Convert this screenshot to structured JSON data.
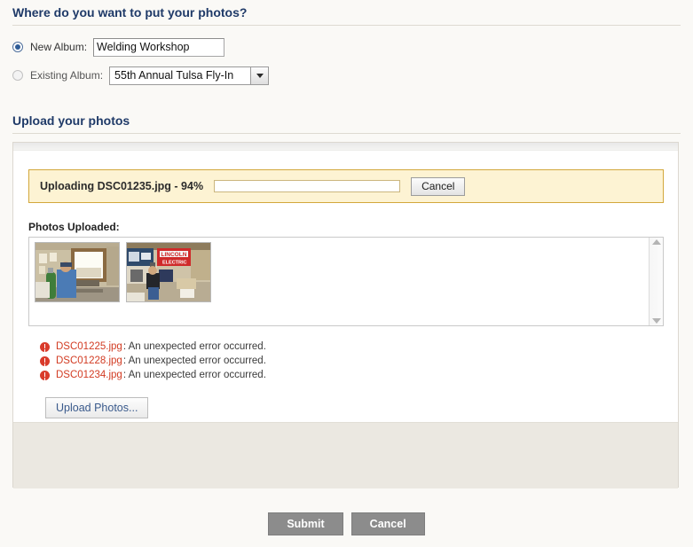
{
  "destination": {
    "heading": "Where do you want to put your photos?",
    "new_album": {
      "label": "New Album:",
      "selected": true,
      "value": "Welding Workshop",
      "placeholder": ""
    },
    "existing_album": {
      "label": "Existing Album:",
      "selected": false,
      "value": "55th Annual Tulsa Fly-In",
      "options": [
        "55th Annual Tulsa Fly-In"
      ]
    }
  },
  "upload": {
    "heading": "Upload your photos",
    "status": {
      "text": "Uploading DSC01235.jpg - 94%",
      "percent": 94,
      "cancel_label": "Cancel",
      "bar_color": "#12a2dd",
      "box_background": "#fdf3d3",
      "box_border": "#d3a83c"
    },
    "photos_label": "Photos Uploaded:",
    "thumbnails": [
      {
        "alt": "Man in blue shirt with green gas cylinder beside bright window in workshop"
      },
      {
        "alt": "Workshop with red LINCOLN ELECTRIC banner and person in dark jacket"
      }
    ],
    "errors": [
      {
        "file": "DSC01225.jpg",
        "message": ": An unexpected error occurred."
      },
      {
        "file": "DSC01228.jpg",
        "message": ": An unexpected error occurred."
      },
      {
        "file": "DSC01234.jpg",
        "message": ": An unexpected error occurred."
      }
    ],
    "error_color": "#d23b22",
    "upload_button_label": "Upload Photos..."
  },
  "actions": {
    "submit_label": "Submit",
    "cancel_label": "Cancel"
  }
}
